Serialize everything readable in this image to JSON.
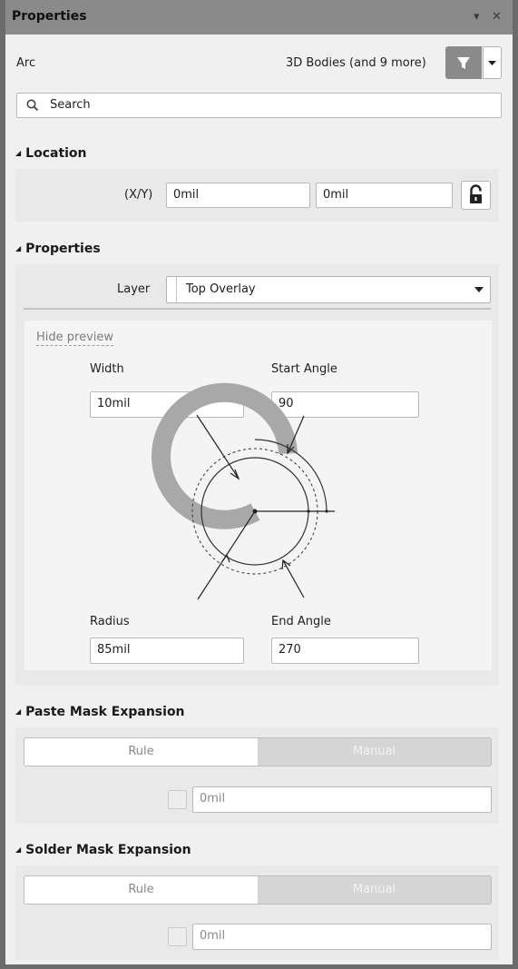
{
  "window": {
    "title": "Properties",
    "pin_icon": "▾",
    "close_icon": "✕"
  },
  "header": {
    "object_type": "Arc",
    "filter_text": "3D Bodies (and 9 more)"
  },
  "search": {
    "placeholder": "Search"
  },
  "location": {
    "heading": "Location",
    "xy_label": "(X/Y)",
    "x_value": "0mil",
    "y_value": "0mil"
  },
  "properties": {
    "heading": "Properties",
    "layer_label": "Layer",
    "layer_value": "Top Overlay",
    "hide_preview": "Hide preview",
    "width_label": "Width",
    "width_value": "10mil",
    "start_angle_label": "Start Angle",
    "start_angle_value": "90",
    "radius_label": "Radius",
    "radius_value": "85mil",
    "end_angle_label": "End Angle",
    "end_angle_value": "270"
  },
  "paste_mask": {
    "heading": "Paste Mask Expansion",
    "rule_label": "Rule",
    "manual_label": "Manual",
    "value": "0mil"
  },
  "solder_mask": {
    "heading": "Solder Mask Expansion",
    "rule_label": "Rule",
    "manual_label": "Manual",
    "value": "0mil"
  },
  "colors": {
    "titlebar": "#8a8a8a",
    "panel": "#f0f0f0",
    "arc_fill": "#a8a8a8"
  }
}
